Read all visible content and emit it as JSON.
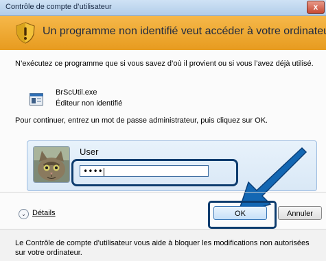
{
  "window": {
    "title": "Contrôle de compte d’utilisateur",
    "close_label": "x"
  },
  "banner": {
    "text": "Un programme non identifié veut accéder à votre ordinateur.",
    "icon": "warning-shield-icon"
  },
  "message": "N’exécutez ce programme que si vous savez d’où il provient ou si vous l’avez déjà utilisé.",
  "program": {
    "name": "BrScUtil.exe",
    "publisher": "Éditeur non identifié",
    "icon": "program-icon"
  },
  "continue_text": "Pour continuer, entrez un mot de passe administrateur, puis cliquez sur OK.",
  "credential": {
    "user": "User",
    "password_mask": "••••",
    "avatar": "cat-avatar"
  },
  "details_label": "Détails",
  "buttons": {
    "ok": "OK",
    "cancel": "Annuler"
  },
  "footer_text": "Le Contrôle de compte d’utilisateur vous aide à bloquer les modifications non autorisées sur votre ordinateur.",
  "colors": {
    "banner": "#f0a833",
    "highlight": "#0d3c6e",
    "arrow": "#1367b3"
  }
}
